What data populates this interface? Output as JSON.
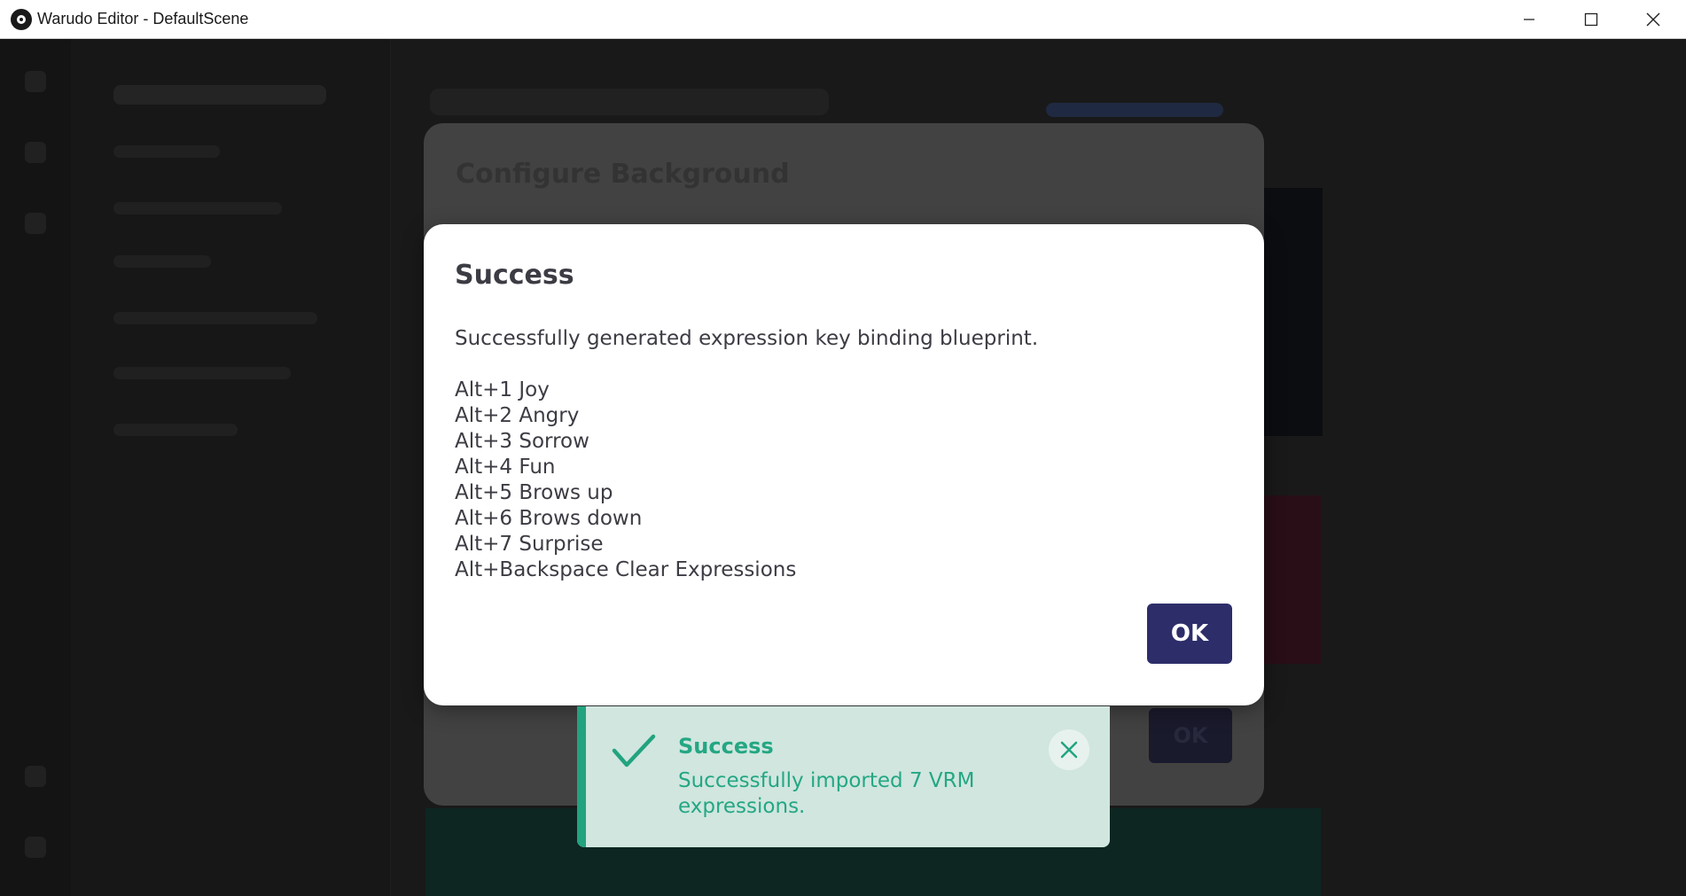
{
  "window": {
    "title": "Warudo Editor - DefaultScene"
  },
  "background_dialog": {
    "title": "Configure Background",
    "ok_label": "OK"
  },
  "dialog": {
    "title": "Success",
    "message": "Successfully generated expression key binding blueprint.",
    "bindings": [
      "Alt+1 Joy",
      "Alt+2 Angry",
      "Alt+3 Sorrow",
      "Alt+4 Fun",
      "Alt+5 Brows up",
      "Alt+6 Brows down",
      "Alt+7 Surprise",
      "Alt+Backspace Clear Expressions"
    ],
    "ok_label": "OK"
  },
  "toast": {
    "title": "Success",
    "message": "Successfully imported 7 VRM expressions.",
    "icon": "check-icon"
  },
  "colors": {
    "ok_button": "#2d2d6a",
    "toast_bg": "#d0e6df",
    "toast_accent": "#22a37f"
  }
}
